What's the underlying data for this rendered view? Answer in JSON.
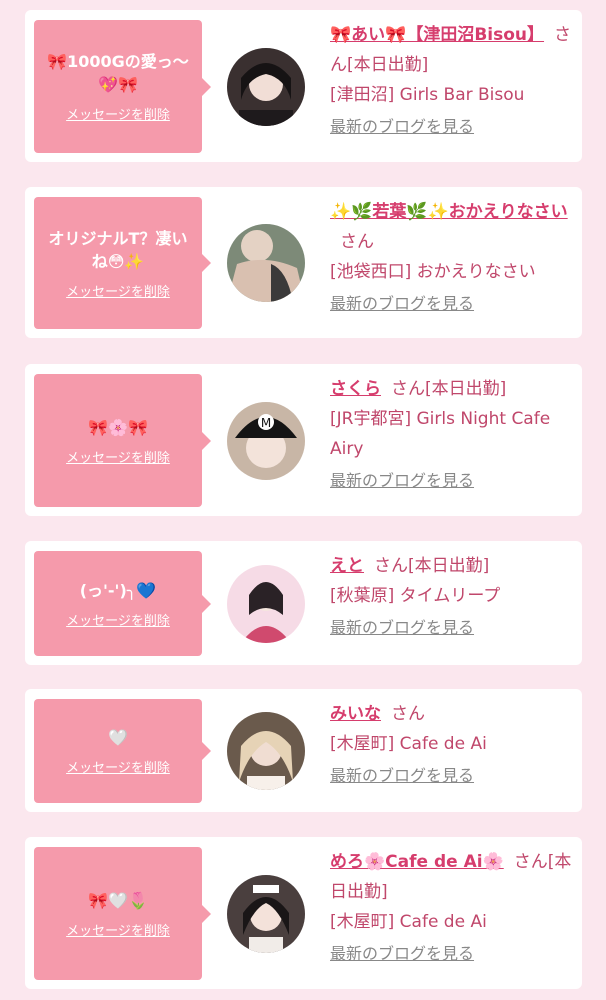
{
  "delete_label": "メッセージを削除",
  "blog_label": "最新のブログを見る",
  "suffix": "さん",
  "colors": {
    "page_bg": "#fbe7ee",
    "bubble": "#f59aab",
    "name": "#d63d6d",
    "text": "#c0476b",
    "link_gray": "#888888"
  },
  "cards": [
    {
      "message": "🎀1000Gの愛っ〜💖🎀",
      "name": "🎀あい🎀【津田沼Bisou】",
      "status": "[本日出勤]",
      "shop": "[津田沼] Girls Bar Bisou"
    },
    {
      "message": "オリジナルT？凄いね😳✨",
      "name": "✨🌿若葉🌿✨おかえりなさい",
      "status": "",
      "shop": "[池袋西口] おかえりなさい"
    },
    {
      "message": "🎀🌸🎀",
      "name": "さくら",
      "status": "[本日出勤]",
      "shop": "[JR宇都宮] Girls Night Cafe Airy"
    },
    {
      "message": "(っ'-')╮💙",
      "name": "えと",
      "status": "[本日出勤]",
      "shop": "[秋葉原] タイムリープ"
    },
    {
      "message": "🤍",
      "name": "みいな",
      "status": "",
      "shop": "[木屋町] Cafe de Ai"
    },
    {
      "message": "🎀🤍🌷",
      "name": "めろ🌸Cafe de Ai🌸",
      "status": "[本日出勤]",
      "shop": "[木屋町] Cafe de Ai"
    }
  ]
}
